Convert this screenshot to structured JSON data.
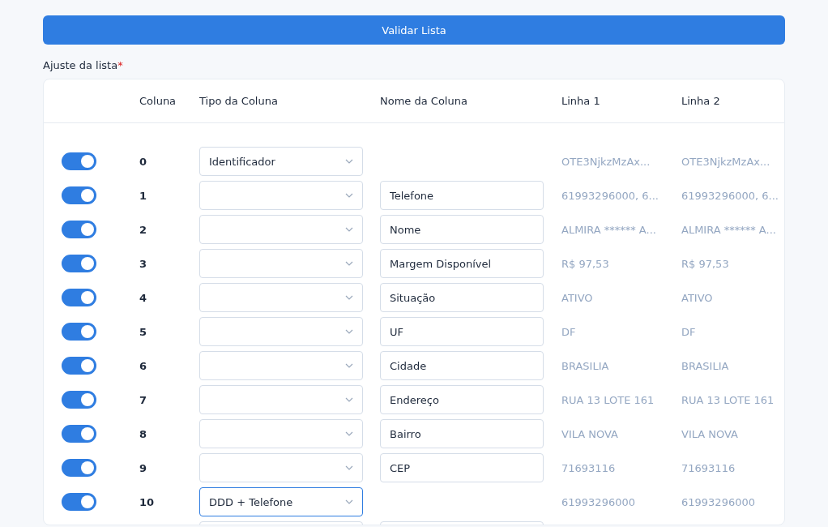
{
  "validate_button": "Validar Lista",
  "section_label": "Ajuste da lista",
  "required_mark": "*",
  "table": {
    "columns": [
      "Coluna",
      "Tipo da Coluna",
      "Nome da Coluna",
      "Linha 1",
      "Linha 2"
    ],
    "rows": [
      {
        "kind": "full",
        "enabled": true,
        "column": "0",
        "type": "Identificador",
        "focused": false,
        "line_1": "OTE3NjkzMzAx...",
        "line_2": "OTE3NjkzMzAx..."
      },
      {
        "kind": "full",
        "enabled": true,
        "column": "1",
        "focused": false,
        "name": "Telefone",
        "line_1": "61993296000, 6...",
        "line_2": "61993296000, 6..."
      },
      {
        "kind": "full",
        "enabled": true,
        "column": "2",
        "focused": false,
        "name": "Nome",
        "line_1": "ALMIRA ****** A...",
        "line_2": "ALMIRA ****** A..."
      },
      {
        "kind": "full",
        "enabled": true,
        "column": "3",
        "focused": false,
        "name": "Margem Disponível",
        "line_1": "R$ 97,53",
        "line_2": "R$ 97,53"
      },
      {
        "kind": "full",
        "enabled": true,
        "column": "4",
        "focused": false,
        "name": "Situação",
        "line_1": "ATIVO",
        "line_2": "ATIVO"
      },
      {
        "kind": "full",
        "enabled": true,
        "column": "5",
        "focused": false,
        "name": "UF",
        "line_1": "DF",
        "line_2": "DF"
      },
      {
        "kind": "full",
        "enabled": true,
        "column": "6",
        "focused": false,
        "name": "Cidade",
        "line_1": "BRASILIA",
        "line_2": "BRASILIA"
      },
      {
        "kind": "full",
        "enabled": true,
        "column": "7",
        "focused": false,
        "name": "Endereço",
        "line_1": "RUA 13 LOTE 161",
        "line_2": "RUA 13 LOTE 161"
      },
      {
        "kind": "full",
        "enabled": true,
        "column": "8",
        "focused": false,
        "name": "Bairro",
        "line_1": "VILA NOVA",
        "line_2": "VILA NOVA"
      },
      {
        "kind": "full",
        "enabled": true,
        "column": "9",
        "focused": false,
        "name": "CEP",
        "line_1": "71693116",
        "line_2": "71693116"
      },
      {
        "kind": "full",
        "enabled": true,
        "column": "10",
        "type": "DDD + Telefone",
        "focused": true,
        "line_1": "61993296000",
        "line_2": "61993296000"
      },
      {
        "kind": "cut",
        "focused": false,
        "name": ""
      }
    ]
  }
}
